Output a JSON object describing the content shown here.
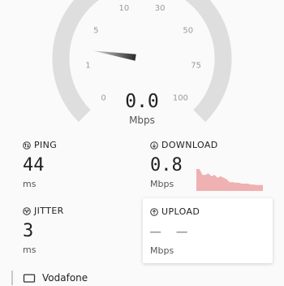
{
  "gauge": {
    "ticks": [
      "0",
      "1",
      "5",
      "10",
      "30",
      "50",
      "75",
      "100"
    ],
    "value": "0.0",
    "unit": "Mbps",
    "needle_fraction": 0.2
  },
  "ping": {
    "label": "PING",
    "value": "44",
    "unit": "ms",
    "icon": "ping-arrows-icon"
  },
  "download": {
    "label": "DOWNLOAD",
    "value": "0.8",
    "unit": "Mbps",
    "icon": "download-arrow-icon",
    "spark_color": "#efb1b1",
    "spark_series": [
      0.75,
      0.75,
      0.55,
      0.55,
      0.6,
      0.5,
      0.55,
      0.45,
      0.5,
      0.45,
      0.4,
      0.3,
      0.3,
      0.28,
      0.28,
      0.25,
      0.25,
      0.25,
      0.22,
      0.22,
      0.2,
      0.2,
      0.2
    ]
  },
  "jitter": {
    "label": "JITTER",
    "value": "3",
    "unit": "ms",
    "icon": "jitter-wave-icon"
  },
  "upload": {
    "label": "UPLOAD",
    "value": "— —",
    "unit": "Mbps",
    "icon": "upload-arrow-icon"
  },
  "network": {
    "name": "Vodafone",
    "icon": "wifi-device-icon"
  }
}
